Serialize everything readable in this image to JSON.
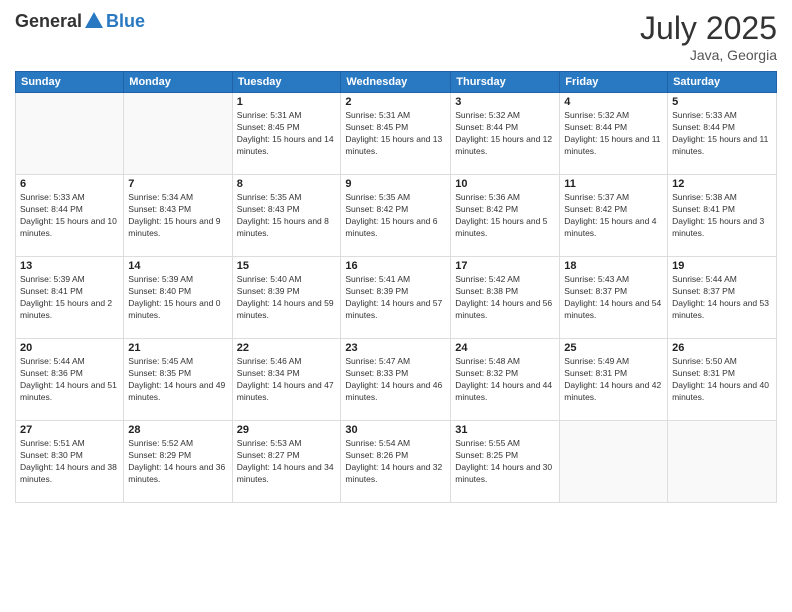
{
  "logo": {
    "general": "General",
    "blue": "Blue"
  },
  "title": {
    "month": "July 2025",
    "location": "Java, Georgia"
  },
  "weekdays": [
    "Sunday",
    "Monday",
    "Tuesday",
    "Wednesday",
    "Thursday",
    "Friday",
    "Saturday"
  ],
  "weeks": [
    [
      {
        "day": null
      },
      {
        "day": null
      },
      {
        "day": "1",
        "sunrise": "Sunrise: 5:31 AM",
        "sunset": "Sunset: 8:45 PM",
        "daylight": "Daylight: 15 hours and 14 minutes."
      },
      {
        "day": "2",
        "sunrise": "Sunrise: 5:31 AM",
        "sunset": "Sunset: 8:45 PM",
        "daylight": "Daylight: 15 hours and 13 minutes."
      },
      {
        "day": "3",
        "sunrise": "Sunrise: 5:32 AM",
        "sunset": "Sunset: 8:44 PM",
        "daylight": "Daylight: 15 hours and 12 minutes."
      },
      {
        "day": "4",
        "sunrise": "Sunrise: 5:32 AM",
        "sunset": "Sunset: 8:44 PM",
        "daylight": "Daylight: 15 hours and 11 minutes."
      },
      {
        "day": "5",
        "sunrise": "Sunrise: 5:33 AM",
        "sunset": "Sunset: 8:44 PM",
        "daylight": "Daylight: 15 hours and 11 minutes."
      }
    ],
    [
      {
        "day": "6",
        "sunrise": "Sunrise: 5:33 AM",
        "sunset": "Sunset: 8:44 PM",
        "daylight": "Daylight: 15 hours and 10 minutes."
      },
      {
        "day": "7",
        "sunrise": "Sunrise: 5:34 AM",
        "sunset": "Sunset: 8:43 PM",
        "daylight": "Daylight: 15 hours and 9 minutes."
      },
      {
        "day": "8",
        "sunrise": "Sunrise: 5:35 AM",
        "sunset": "Sunset: 8:43 PM",
        "daylight": "Daylight: 15 hours and 8 minutes."
      },
      {
        "day": "9",
        "sunrise": "Sunrise: 5:35 AM",
        "sunset": "Sunset: 8:42 PM",
        "daylight": "Daylight: 15 hours and 6 minutes."
      },
      {
        "day": "10",
        "sunrise": "Sunrise: 5:36 AM",
        "sunset": "Sunset: 8:42 PM",
        "daylight": "Daylight: 15 hours and 5 minutes."
      },
      {
        "day": "11",
        "sunrise": "Sunrise: 5:37 AM",
        "sunset": "Sunset: 8:42 PM",
        "daylight": "Daylight: 15 hours and 4 minutes."
      },
      {
        "day": "12",
        "sunrise": "Sunrise: 5:38 AM",
        "sunset": "Sunset: 8:41 PM",
        "daylight": "Daylight: 15 hours and 3 minutes."
      }
    ],
    [
      {
        "day": "13",
        "sunrise": "Sunrise: 5:39 AM",
        "sunset": "Sunset: 8:41 PM",
        "daylight": "Daylight: 15 hours and 2 minutes."
      },
      {
        "day": "14",
        "sunrise": "Sunrise: 5:39 AM",
        "sunset": "Sunset: 8:40 PM",
        "daylight": "Daylight: 15 hours and 0 minutes."
      },
      {
        "day": "15",
        "sunrise": "Sunrise: 5:40 AM",
        "sunset": "Sunset: 8:39 PM",
        "daylight": "Daylight: 14 hours and 59 minutes."
      },
      {
        "day": "16",
        "sunrise": "Sunrise: 5:41 AM",
        "sunset": "Sunset: 8:39 PM",
        "daylight": "Daylight: 14 hours and 57 minutes."
      },
      {
        "day": "17",
        "sunrise": "Sunrise: 5:42 AM",
        "sunset": "Sunset: 8:38 PM",
        "daylight": "Daylight: 14 hours and 56 minutes."
      },
      {
        "day": "18",
        "sunrise": "Sunrise: 5:43 AM",
        "sunset": "Sunset: 8:37 PM",
        "daylight": "Daylight: 14 hours and 54 minutes."
      },
      {
        "day": "19",
        "sunrise": "Sunrise: 5:44 AM",
        "sunset": "Sunset: 8:37 PM",
        "daylight": "Daylight: 14 hours and 53 minutes."
      }
    ],
    [
      {
        "day": "20",
        "sunrise": "Sunrise: 5:44 AM",
        "sunset": "Sunset: 8:36 PM",
        "daylight": "Daylight: 14 hours and 51 minutes."
      },
      {
        "day": "21",
        "sunrise": "Sunrise: 5:45 AM",
        "sunset": "Sunset: 8:35 PM",
        "daylight": "Daylight: 14 hours and 49 minutes."
      },
      {
        "day": "22",
        "sunrise": "Sunrise: 5:46 AM",
        "sunset": "Sunset: 8:34 PM",
        "daylight": "Daylight: 14 hours and 47 minutes."
      },
      {
        "day": "23",
        "sunrise": "Sunrise: 5:47 AM",
        "sunset": "Sunset: 8:33 PM",
        "daylight": "Daylight: 14 hours and 46 minutes."
      },
      {
        "day": "24",
        "sunrise": "Sunrise: 5:48 AM",
        "sunset": "Sunset: 8:32 PM",
        "daylight": "Daylight: 14 hours and 44 minutes."
      },
      {
        "day": "25",
        "sunrise": "Sunrise: 5:49 AM",
        "sunset": "Sunset: 8:31 PM",
        "daylight": "Daylight: 14 hours and 42 minutes."
      },
      {
        "day": "26",
        "sunrise": "Sunrise: 5:50 AM",
        "sunset": "Sunset: 8:31 PM",
        "daylight": "Daylight: 14 hours and 40 minutes."
      }
    ],
    [
      {
        "day": "27",
        "sunrise": "Sunrise: 5:51 AM",
        "sunset": "Sunset: 8:30 PM",
        "daylight": "Daylight: 14 hours and 38 minutes."
      },
      {
        "day": "28",
        "sunrise": "Sunrise: 5:52 AM",
        "sunset": "Sunset: 8:29 PM",
        "daylight": "Daylight: 14 hours and 36 minutes."
      },
      {
        "day": "29",
        "sunrise": "Sunrise: 5:53 AM",
        "sunset": "Sunset: 8:27 PM",
        "daylight": "Daylight: 14 hours and 34 minutes."
      },
      {
        "day": "30",
        "sunrise": "Sunrise: 5:54 AM",
        "sunset": "Sunset: 8:26 PM",
        "daylight": "Daylight: 14 hours and 32 minutes."
      },
      {
        "day": "31",
        "sunrise": "Sunrise: 5:55 AM",
        "sunset": "Sunset: 8:25 PM",
        "daylight": "Daylight: 14 hours and 30 minutes."
      },
      {
        "day": null
      },
      {
        "day": null
      }
    ]
  ]
}
